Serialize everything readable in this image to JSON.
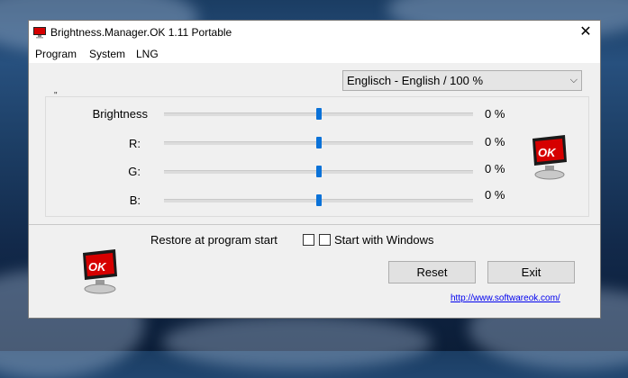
{
  "window": {
    "title": "Brightness.Manager.OK 1.11 Portable",
    "close_glyph": "✕"
  },
  "menu": {
    "items": [
      "Program",
      "System",
      "LNG"
    ]
  },
  "language_select": {
    "value": "Englisch - English / 100 %",
    "chevron": "⌵"
  },
  "group_marker": "\"",
  "sliders": [
    {
      "label": "Brightness",
      "value_text": "0 %",
      "level": 0.5
    },
    {
      "label": "R:",
      "value_text": "0 %",
      "level": 0.5
    },
    {
      "label": "G:",
      "value_text": "0 %",
      "level": 0.5
    },
    {
      "label": "B:",
      "value_text": "0 %",
      "level": 0.5
    }
  ],
  "options": {
    "restore_label": "Restore at program start",
    "restore_checked": false,
    "start_label": "Start with Windows",
    "start_checked": false
  },
  "buttons": {
    "reset": "Reset",
    "exit": "Exit"
  },
  "link": "http://www.softwareok.com/",
  "logo_text": "OK",
  "colors": {
    "accent": "#0b72d8",
    "logo_red": "#d60000",
    "link": "#0000ee"
  }
}
